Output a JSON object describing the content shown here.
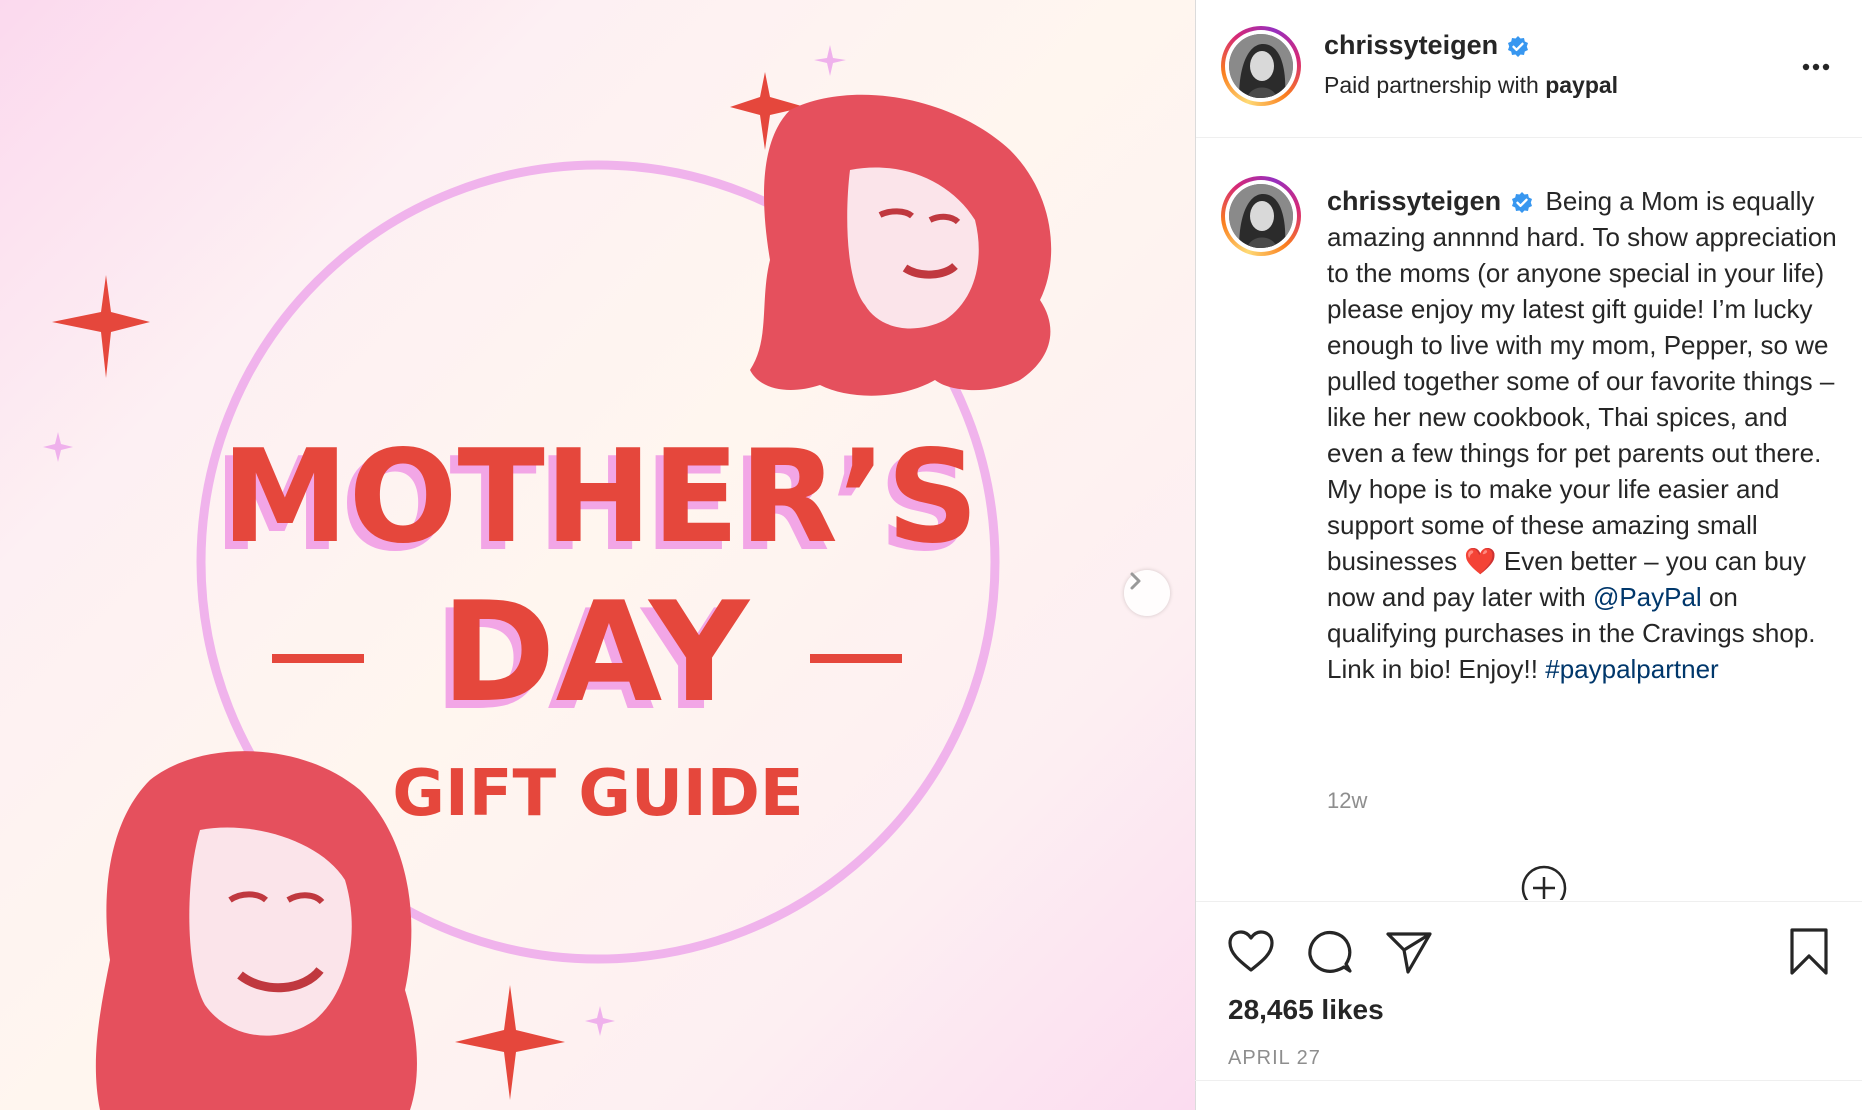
{
  "image": {
    "title_line1": "MOTHER’S",
    "title_line2": "DAY",
    "subtitle": "GIFT GUIDE",
    "colors": {
      "accent": "#e5473c",
      "shadow": "#f2a6e6",
      "circle": "#f0b3ec"
    }
  },
  "header": {
    "username": "chrissyteigen",
    "partnership_prefix": "Paid partnership with ",
    "partner": "paypal",
    "more_icon": "more-horizontal-icon"
  },
  "caption": {
    "username": "chrissyteigen",
    "text_part1": "Being a Mom is equally amazing annnnd hard. To show appreciation to the moms (or anyone special in your life) please enjoy my latest gift guide! I’m lucky enough to live with my mom, Pepper, so we pulled together some of our favorite things – like her new cookbook, Thai spices, and even a few things for pet parents out there. My hope is to make your life easier and support some of these amazing small businesses ",
    "emoji": "❤️",
    "text_part2": " Even better – you can buy now and pay later with ",
    "mention": "@PayPal",
    "text_part3": " on qualifying purchases in the Cravings shop. Link in bio! Enjoy!! ",
    "hashtag": "#paypalpartner",
    "time_ago": "12w"
  },
  "actions": {
    "likes": "28,465 likes",
    "date": "APRIL 27"
  }
}
